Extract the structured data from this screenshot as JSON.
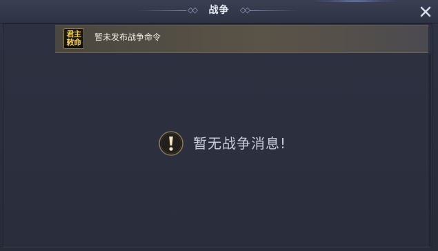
{
  "header": {
    "title": "战争",
    "close_icon": "close-icon"
  },
  "notice": {
    "badge_line1": "君主",
    "badge_line2": "敕命",
    "text": "暂未发布战争命令"
  },
  "empty_state": {
    "icon": "warning-icon",
    "message": "暂无战争消息!"
  },
  "colors": {
    "background": "#2a2e3c",
    "badge_text": "#f2c84b",
    "warning_icon": "#f3e6c4"
  }
}
